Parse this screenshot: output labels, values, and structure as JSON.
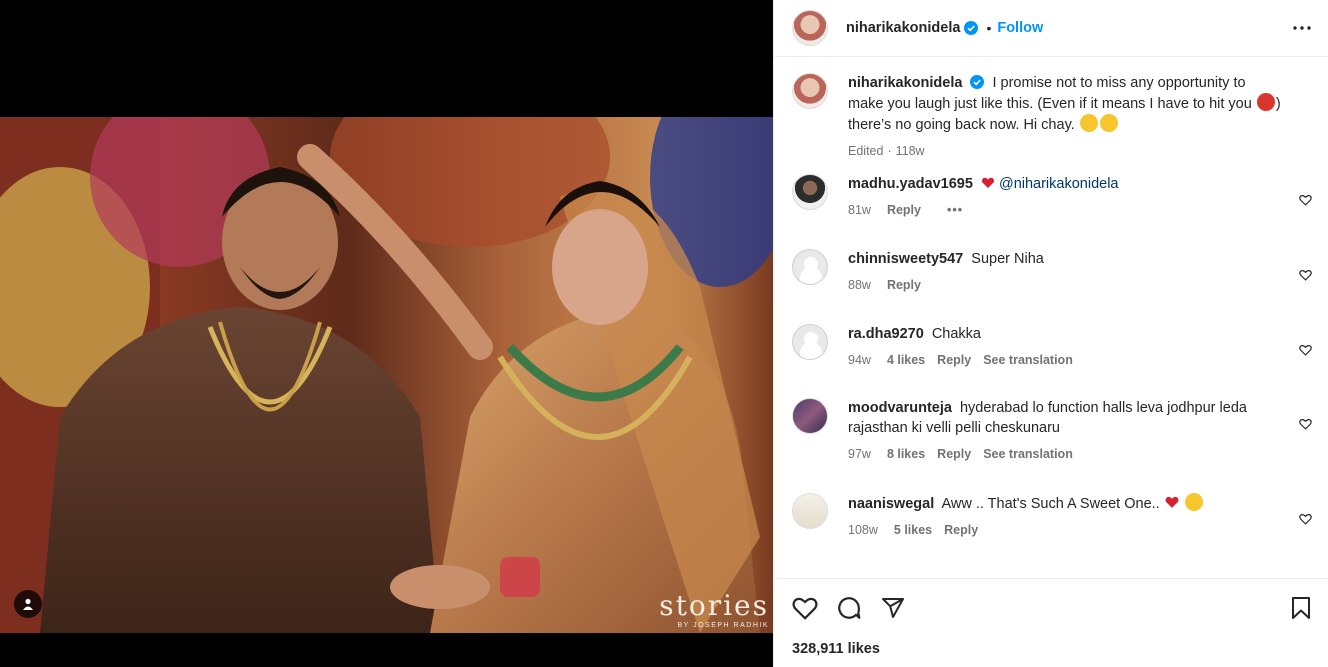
{
  "post": {
    "username": "niharikakonidela",
    "follow_label": "Follow",
    "separator": "•",
    "caption": "I promise not to miss any opportunity to make you laugh just like this. (Even if it means I have to hit you",
    "caption_tail": ") there’s no going back now. Hi chay.",
    "caption_meta_edited": "Edited",
    "caption_meta_sep": "·",
    "caption_time": "118w",
    "watermark_main": "stories",
    "watermark_sub": "BY JOSEPH RADHIK",
    "likes": "328,911 likes"
  },
  "comments": [
    {
      "username": "madhu.yadav1695",
      "text": "@niharikakonidela",
      "time": "81w",
      "likes": "",
      "reply": "Reply",
      "translate": "",
      "more": "•••",
      "avatar": "man-avatar"
    },
    {
      "username": "chinnisweety547",
      "text": "Super Niha",
      "time": "88w",
      "likes": "",
      "reply": "Reply",
      "translate": "",
      "more": "",
      "avatar": "default-avatar"
    },
    {
      "username": "ra.dha9270",
      "text": "Chakka",
      "time": "94w",
      "likes": "4 likes",
      "reply": "Reply",
      "translate": "See translation",
      "more": "",
      "avatar": "default-avatar"
    },
    {
      "username": "moodvarunteja",
      "text": "hyderabad lo function halls leva jodhpur leda rajasthan ki velli pelli cheskunaru",
      "time": "97w",
      "likes": "8 likes",
      "reply": "Reply",
      "translate": "See translation",
      "more": "",
      "avatar": "group-avatar"
    },
    {
      "username": "naaniswegal",
      "text": "Aww .. That's Such A Sweet One..",
      "time": "108w",
      "likes": "5 likes",
      "reply": "Reply",
      "translate": "",
      "more": "",
      "avatar": "book-avatar"
    }
  ],
  "icons": [
    "verified-badge-icon",
    "more-options-icon",
    "heart-icon",
    "comment-icon",
    "share-icon",
    "bookmark-icon",
    "user-tag-icon",
    "emoji-icon"
  ],
  "colors": {
    "link": "#0095f6",
    "mention": "#00376b",
    "muted": "#737373",
    "verified": "#0095f6"
  }
}
